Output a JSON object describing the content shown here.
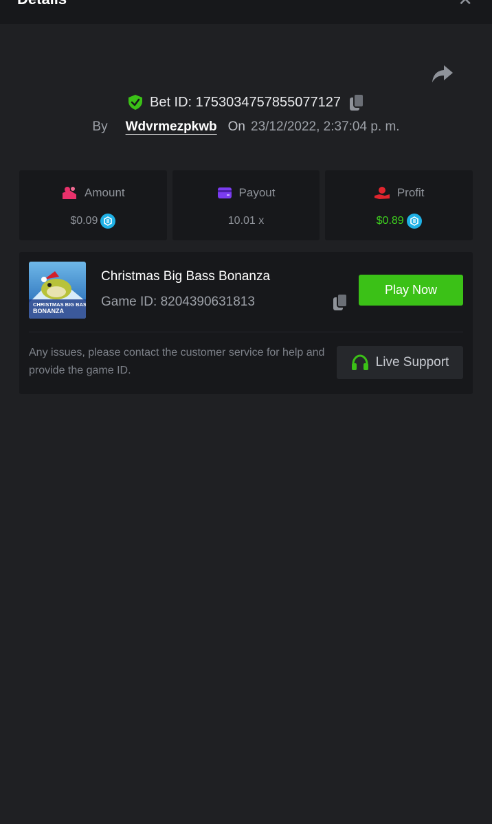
{
  "header": {
    "title": "Details",
    "close_glyph": "✕"
  },
  "bet": {
    "id_text": "Bet ID: 1753034757855077127",
    "by_label": "By",
    "username": "Wdvrmezpkwb",
    "on_label": "On",
    "datetime": "23/12/2022, 2:37:04 p. m."
  },
  "stats": {
    "amount": {
      "label": "Amount",
      "value": "$0.09"
    },
    "payout": {
      "label": "Payout",
      "value": "10.01 x"
    },
    "profit": {
      "label": "Profit",
      "value": "$0.89"
    }
  },
  "game": {
    "name": "Christmas Big Bass Bonanza",
    "id_text": "Game ID: 8204390631813",
    "thumbnail_text_line1": "CHRISTMAS BIG BASS",
    "thumbnail_text_line2": "BONANZA",
    "play_label": "Play Now"
  },
  "support": {
    "notice": "Any issues, please contact the customer service for help and provide the game ID.",
    "button_label": "Live Support"
  },
  "icons": {
    "shield": "shield-check-icon",
    "copy": "copy-icon",
    "share": "share-icon",
    "amount": "amount-icon",
    "payout": "wallet-icon",
    "profit": "profit-hand-icon",
    "coin": "coin-icon",
    "headset": "headset-icon"
  },
  "colors": {
    "background": "#1f2023",
    "card": "#17181b",
    "accent_green": "#3bc117",
    "profit_green": "#3fd21f",
    "coin_blue": "#1fb1e6",
    "amount_pink": "#e8316b",
    "payout_purple": "#7b3cf0",
    "profit_red": "#e0252e"
  }
}
